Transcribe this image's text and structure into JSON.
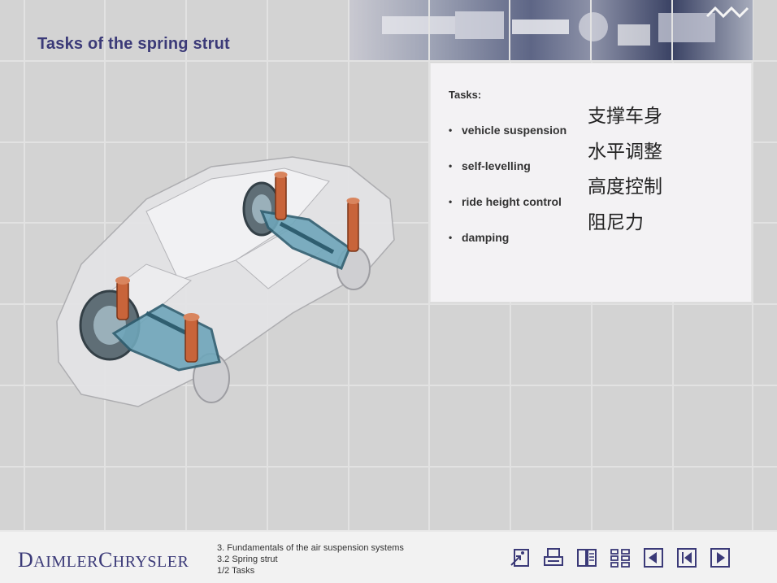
{
  "page": {
    "title": "Tasks of the spring strut"
  },
  "tasks_panel": {
    "heading": "Tasks:",
    "items": [
      "vehicle suspension",
      "self-levelling",
      "ride height control",
      "damping"
    ],
    "chinese_items": [
      "支撑车身",
      "水平调整",
      "高度控制",
      "阻尼力"
    ]
  },
  "footer": {
    "brand_first": "D",
    "brand_first_rest": "AIMLER",
    "brand_second": "C",
    "brand_second_rest": "HRYSLER",
    "breadcrumb": [
      "3. Fundamentals of the air suspension systems",
      "3.2 Spring strut",
      "1/2 Tasks"
    ],
    "nav_icons": [
      "exit-icon",
      "print-icon",
      "glossary-icon",
      "contents-icon",
      "previous-icon",
      "first-page-icon",
      "next-icon"
    ]
  },
  "colors": {
    "title": "#3b3a78",
    "background": "#d3d3d3",
    "panel": "#f3f2f4",
    "strut": "#c8643a",
    "axle": "#4c8ea6"
  }
}
